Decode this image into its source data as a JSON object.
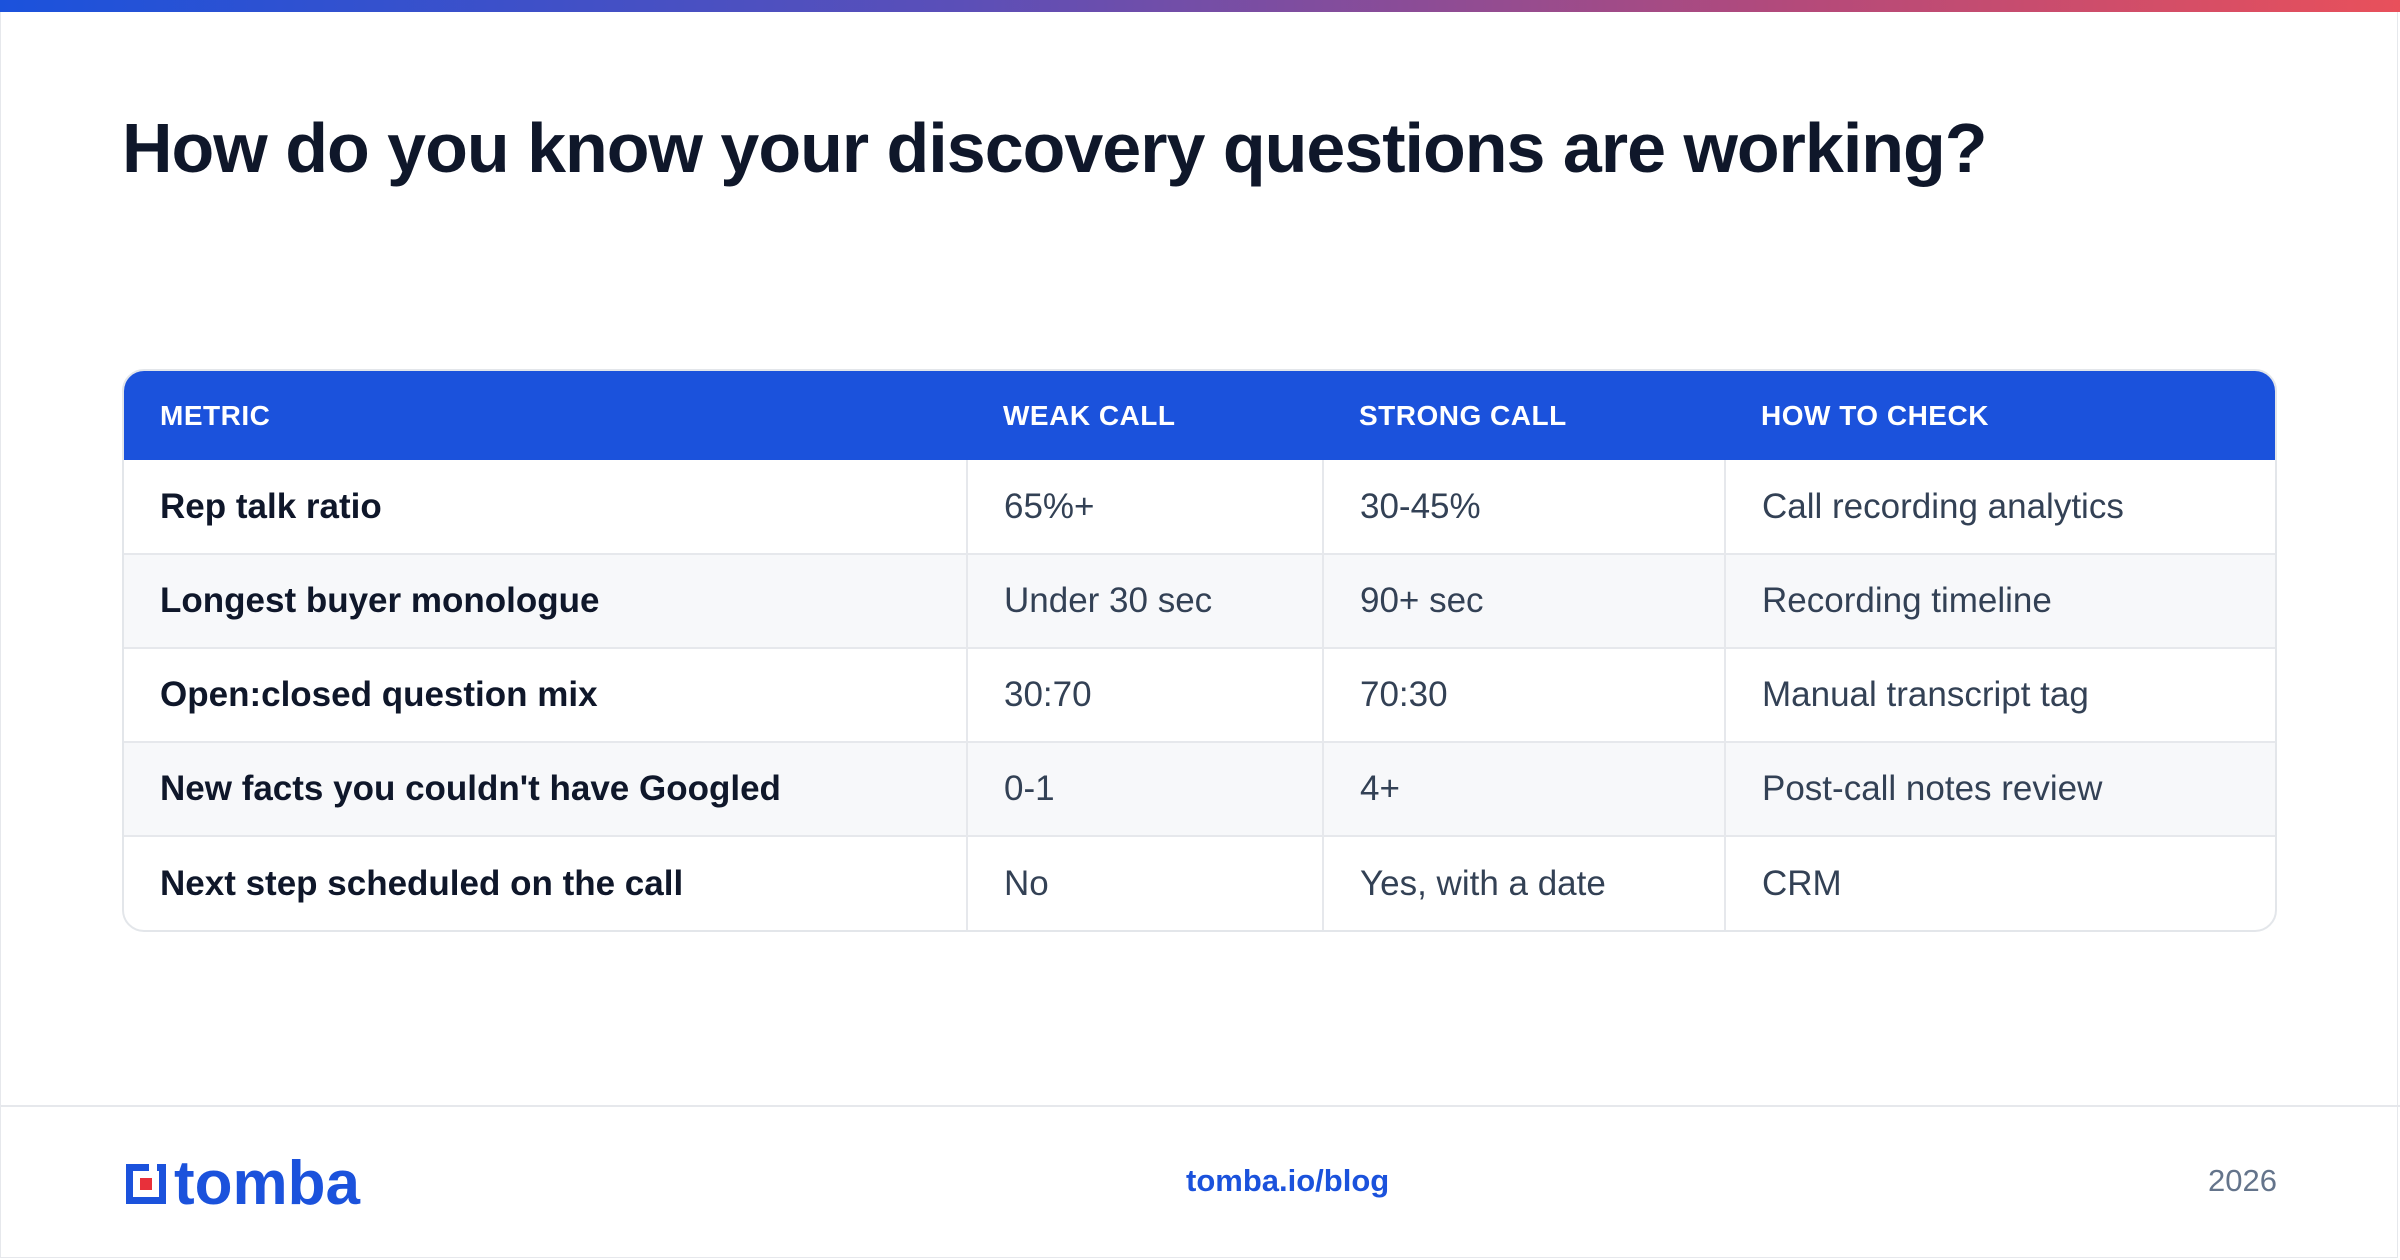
{
  "title": "How do you know your discovery questions are working?",
  "colors": {
    "accent": "#1b52dc",
    "heading": "#0f172a",
    "body_text": "#334155",
    "logo_red": "#e8303a"
  },
  "table": {
    "headers": [
      "METRIC",
      "WEAK CALL",
      "STRONG CALL",
      "HOW TO CHECK"
    ],
    "rows": [
      [
        "Rep talk ratio",
        "65%+",
        "30-45%",
        "Call recording analytics"
      ],
      [
        "Longest buyer monologue",
        "Under 30 sec",
        "90+ sec",
        "Recording timeline"
      ],
      [
        "Open:closed question mix",
        "30:70",
        "70:30",
        "Manual transcript tag"
      ],
      [
        "New facts you couldn't have Googled",
        "0-1",
        "4+",
        "Post-call notes review"
      ],
      [
        "Next step scheduled on the call",
        "No",
        "Yes, with a date",
        "CRM"
      ]
    ]
  },
  "footer": {
    "logo_text": "tomba",
    "logo_icon": "tomba-logo-icon",
    "link": "tomba.io/blog",
    "year": "2026"
  }
}
